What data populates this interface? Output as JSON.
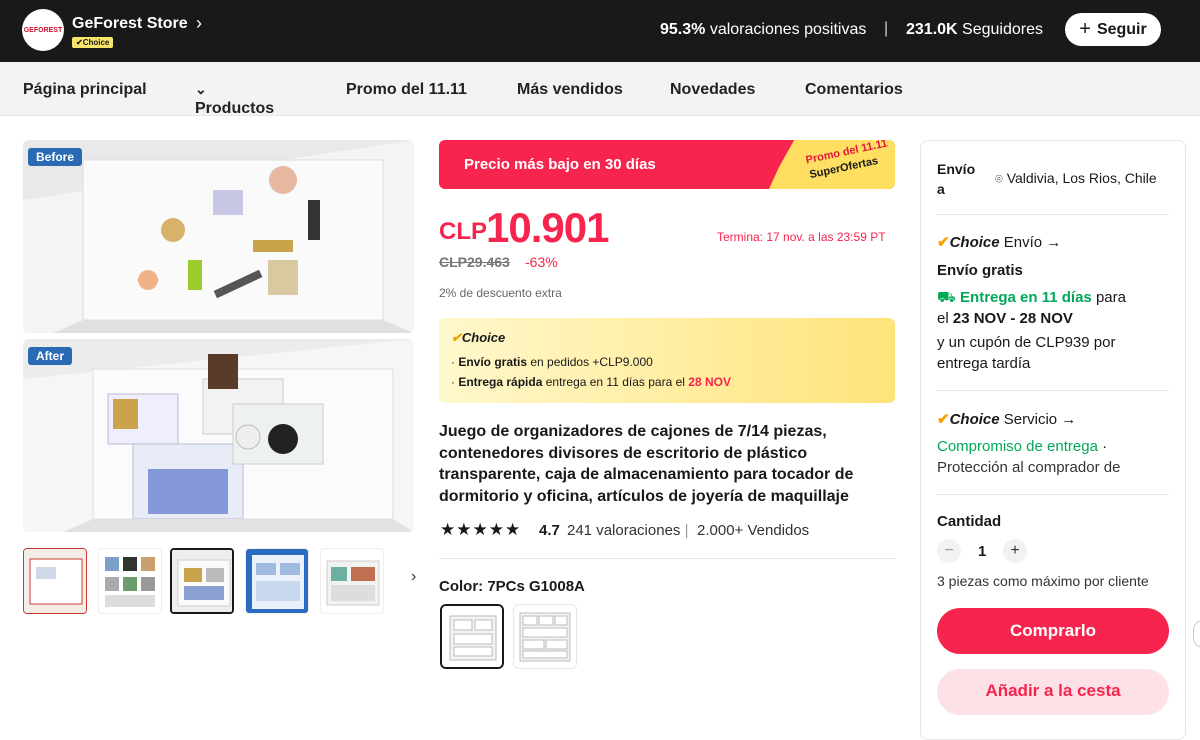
{
  "store": {
    "name": "GeForest Store",
    "logo_text": "GEFOREST",
    "badge": "Choice",
    "positive_pct": "95.3%",
    "positive_label": "valoraciones positivas",
    "followers": "231.0K",
    "followers_label": "Seguidores",
    "follow_label": "Seguir"
  },
  "nav": [
    "Página principal",
    "Productos",
    "Promo del 11.11",
    "Más vendidos",
    "Novedades",
    "Comentarios"
  ],
  "gallery": {
    "before": "Before",
    "after": "After"
  },
  "promo": {
    "text": "Precio más bajo en 30 días",
    "badge_line1": "Promo del 11.11",
    "badge_line2": "SuperOfertas"
  },
  "price": {
    "currency": "CLP",
    "value": "10.901",
    "ends": "Termina: 17 nov. a las 23:59 PT",
    "old": "CLP29.463",
    "discount": "-63%",
    "extra": "2% de descuento extra"
  },
  "choice_box": {
    "header": "Choice",
    "line1_bold": "Envío gratis",
    "line1_rest": "en pedidos +CLP9.000",
    "line2_bold": "Entrega rápida",
    "line2_rest": "entrega en 11 días para el",
    "line2_date": "28 NOV"
  },
  "product": {
    "title": "Juego de organizadores de cajones de 7/14 piezas, contenedores divisores de escritorio de plástico transparente, caja de almacenamiento para tocador de dormitorio y oficina, artículos de joyería de maquillaje",
    "stars": "★★★★★",
    "rating": "4.7",
    "reviews": "241 valoraciones",
    "sold": "2.000+ Vendidos",
    "color_label": "Color: 7PCs G1008A"
  },
  "shipping": {
    "to_label": "Envío a",
    "location": "Valdivia, Los Rios, Chile",
    "choice_title": "Choice",
    "choice_suffix": "Envío",
    "free": "Envío gratis",
    "delivery_green": "Entrega en 11 días",
    "delivery_rest": "para",
    "delivery_line2_pre": "el",
    "delivery_dates": "23 NOV - 28 NOV",
    "coupon": "y un cupón de CLP939 por entrega tardía",
    "service_title": "Choice",
    "service_suffix": "Servicio",
    "commitment": "Compromiso de entrega",
    "protection": "Protección al comprador de"
  },
  "quantity": {
    "label": "Cantidad",
    "value": "1",
    "limit": "3 piezas como máximo por cliente"
  },
  "actions": {
    "buy": "Comprarlo",
    "cart": "Añadir a la cesta"
  },
  "colors": {
    "accent": "#f7244d",
    "green": "#00a859",
    "topbar": "#191919",
    "choice_yellow": "#ffe37a"
  }
}
